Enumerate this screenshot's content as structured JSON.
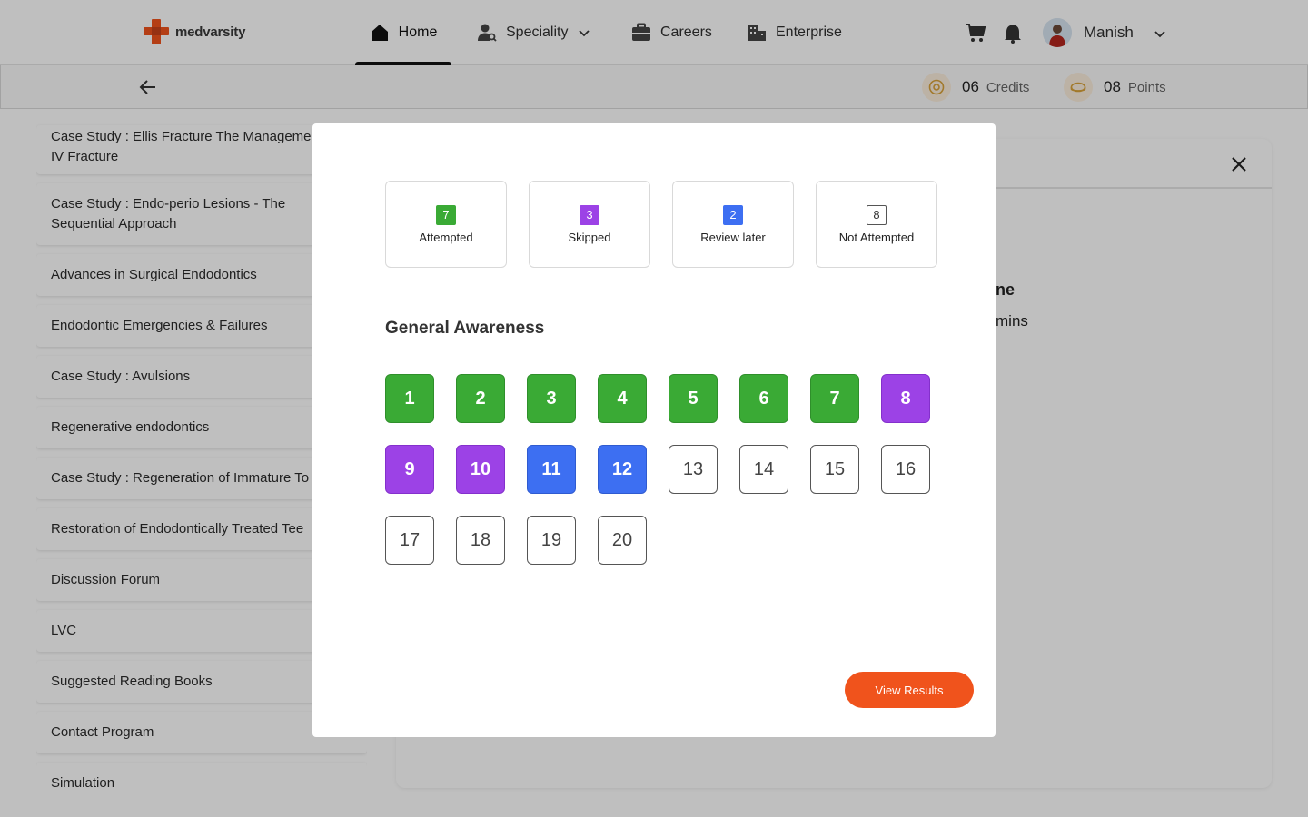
{
  "brand": {
    "name": "medvarsity"
  },
  "nav": {
    "items": [
      {
        "label": "Home",
        "icon": "home-icon",
        "active": true
      },
      {
        "label": "Speciality",
        "icon": "speciality-icon",
        "has_dropdown": true
      },
      {
        "label": "Careers",
        "icon": "briefcase-icon"
      },
      {
        "label": "Enterprise",
        "icon": "building-icon"
      }
    ],
    "user": {
      "name": "Manish"
    }
  },
  "stats": {
    "credits": {
      "value": "06",
      "label": "Credits"
    },
    "points": {
      "value": "08",
      "label": "Points"
    }
  },
  "sidebar": {
    "items": [
      {
        "label": "Case Study : Ellis Fracture The Manageme Class IV Fracture"
      },
      {
        "label": "Case Study : Endo-perio Lesions - The Sequential Approach"
      },
      {
        "label": "Advances in Surgical Endodontics"
      },
      {
        "label": "Endodontic Emergencies & Failures"
      },
      {
        "label": "Case Study : Avulsions"
      },
      {
        "label": "Regenerative endodontics"
      },
      {
        "label": "Case Study : Regeneration of Immature To"
      },
      {
        "label": "Restoration of Endodontically Treated Tee"
      },
      {
        "label": "Discussion Forum"
      },
      {
        "label": "LVC"
      },
      {
        "label": "Suggested Reading Books"
      },
      {
        "label": "Contact Program"
      },
      {
        "label": "Simulation"
      }
    ]
  },
  "background_content": {
    "line1": "ne",
    "line2": "mins"
  },
  "modal": {
    "legend": {
      "attempted": {
        "count": "7",
        "label": "Attempted"
      },
      "skipped": {
        "count": "3",
        "label": "Skipped"
      },
      "review": {
        "count": "2",
        "label": "Review later"
      },
      "not_attempted": {
        "count": "8",
        "label": "Not Attempted"
      }
    },
    "section_title": "General Awareness",
    "questions": [
      {
        "number": "1",
        "status": "attempted"
      },
      {
        "number": "2",
        "status": "attempted"
      },
      {
        "number": "3",
        "status": "attempted"
      },
      {
        "number": "4",
        "status": "attempted"
      },
      {
        "number": "5",
        "status": "attempted"
      },
      {
        "number": "6",
        "status": "attempted"
      },
      {
        "number": "7",
        "status": "attempted"
      },
      {
        "number": "8",
        "status": "skipped"
      },
      {
        "number": "9",
        "status": "skipped"
      },
      {
        "number": "10",
        "status": "skipped"
      },
      {
        "number": "11",
        "status": "review"
      },
      {
        "number": "12",
        "status": "review"
      },
      {
        "number": "13",
        "status": "not_attempted"
      },
      {
        "number": "14",
        "status": "not_attempted"
      },
      {
        "number": "15",
        "status": "not_attempted"
      },
      {
        "number": "16",
        "status": "not_attempted"
      },
      {
        "number": "17",
        "status": "not_attempted"
      },
      {
        "number": "18",
        "status": "not_attempted"
      },
      {
        "number": "19",
        "status": "not_attempted"
      },
      {
        "number": "20",
        "status": "not_attempted"
      }
    ],
    "button_label": "View Results"
  },
  "colors": {
    "attempted": "#3aaa35",
    "skipped": "#9c42e6",
    "review": "#3d6ff2",
    "accent": "#f0531c"
  }
}
